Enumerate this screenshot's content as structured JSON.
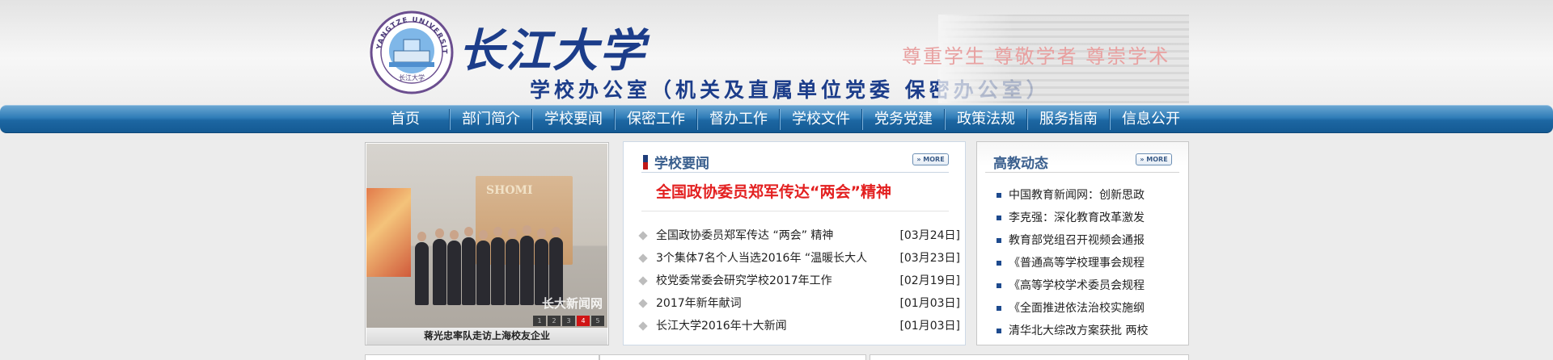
{
  "header": {
    "university_name": "长江大学",
    "office_name": "学校办公室（机关及直属单位党委 保密办公室）",
    "motto": "尊重学生 尊敬学者 尊崇学术",
    "logo_text": "YANGTZE UNIVERSITY",
    "logo_seal_text": "长江大学"
  },
  "nav": {
    "items": [
      {
        "label": "首页"
      },
      {
        "label": "部门简介"
      },
      {
        "label": "学校要闻"
      },
      {
        "label": "保密工作"
      },
      {
        "label": "督办工作"
      },
      {
        "label": "学校文件"
      },
      {
        "label": "党务党建"
      },
      {
        "label": "政策法规"
      },
      {
        "label": "服务指南"
      },
      {
        "label": "信息公开"
      }
    ]
  },
  "slideshow": {
    "caption": "蒋光忠率队走访上海校友企业",
    "watermark": "长大新闻网",
    "dots": [
      "1",
      "2",
      "3",
      "4",
      "5"
    ],
    "active_dot": "4",
    "wall_text": "SHOMI"
  },
  "news": {
    "title": "学校要闻",
    "more_label": "MORE",
    "headline": "全国政协委员郑军传达“两会”精神",
    "items": [
      {
        "title": "全国政协委员郑军传达 “两会” 精神",
        "date": "[03月24日]"
      },
      {
        "title": "3个集体7名个人当选2016年 “温暖长大人",
        "date": "[03月23日]"
      },
      {
        "title": "校党委常委会研究学校2017年工作",
        "date": "[02月19日]"
      },
      {
        "title": "2017年新年献词",
        "date": "[01月03日]"
      },
      {
        "title": "长江大学2016年十大新闻",
        "date": "[01月03日]"
      }
    ]
  },
  "edu": {
    "title": "高教动态",
    "more_label": "MORE",
    "items": [
      {
        "title": "中国教育新闻网：创新思政"
      },
      {
        "title": "李克强：深化教育改革激发"
      },
      {
        "title": "教育部党组召开视频会通报"
      },
      {
        "title": "《普通高等学校理事会规程"
      },
      {
        "title": "《高等学校学术委员会规程"
      },
      {
        "title": "《全面推进依法治校实施纲"
      },
      {
        "title": "清华北大综改方案获批 两校"
      }
    ]
  },
  "colors": {
    "nav_blue": "#2f7cb7",
    "title_blue": "#3a5f8e",
    "headline_red": "#e32020",
    "brand_blue": "#1c3d8a"
  }
}
